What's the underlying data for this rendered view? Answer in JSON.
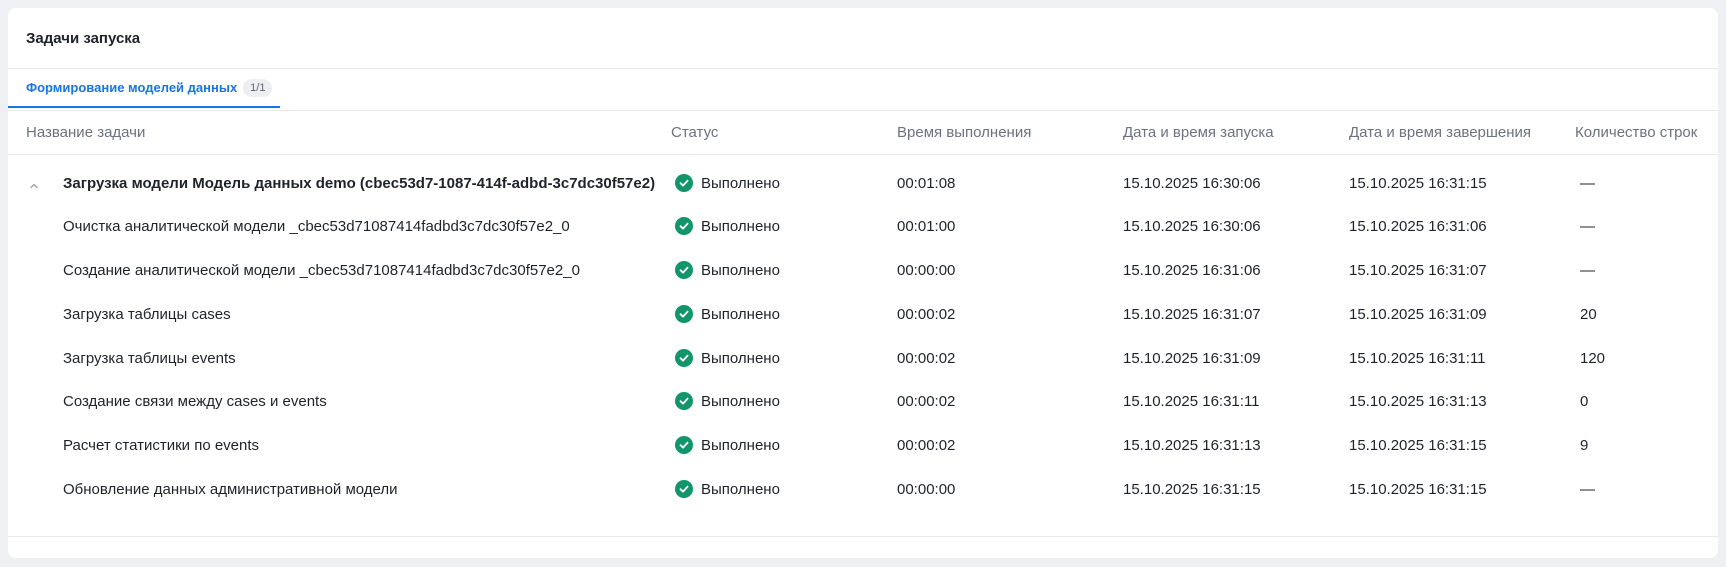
{
  "panel": {
    "title": "Задачи запуска"
  },
  "tabs": [
    {
      "label": "Формирование моделей данных",
      "badge": "1/1"
    }
  ],
  "table": {
    "columns": [
      "Название задачи",
      "Статус",
      "Время выполнения",
      "Дата и время запуска",
      "Дата и время завершения",
      "Количество строк"
    ],
    "rows": [
      {
        "name": "Загрузка модели Модель данных demo (cbec53d7-1087-414f-adbd-3c7dc30f57e2)",
        "status": "Выполнено",
        "duration": "00:01:08",
        "start": "15.10.2025 16:30:06",
        "end": "15.10.2025 16:31:15",
        "rows": "—"
      },
      {
        "name": "Очистка аналитической модели _cbec53d71087414fadbd3c7dc30f57e2_0",
        "status": "Выполнено",
        "duration": "00:01:00",
        "start": "15.10.2025 16:30:06",
        "end": "15.10.2025 16:31:06",
        "rows": "—"
      },
      {
        "name": "Создание аналитической модели _cbec53d71087414fadbd3c7dc30f57e2_0",
        "status": "Выполнено",
        "duration": "00:00:00",
        "start": "15.10.2025 16:31:06",
        "end": "15.10.2025 16:31:07",
        "rows": "—"
      },
      {
        "name": "Загрузка таблицы cases",
        "status": "Выполнено",
        "duration": "00:00:02",
        "start": "15.10.2025 16:31:07",
        "end": "15.10.2025 16:31:09",
        "rows": "20"
      },
      {
        "name": "Загрузка таблицы events",
        "status": "Выполнено",
        "duration": "00:00:02",
        "start": "15.10.2025 16:31:09",
        "end": "15.10.2025 16:31:11",
        "rows": "120"
      },
      {
        "name": "Создание связи между cases и events",
        "status": "Выполнено",
        "duration": "00:00:02",
        "start": "15.10.2025 16:31:11",
        "end": "15.10.2025 16:31:13",
        "rows": "0"
      },
      {
        "name": "Расчет статистики по events",
        "status": "Выполнено",
        "duration": "00:00:02",
        "start": "15.10.2025 16:31:13",
        "end": "15.10.2025 16:31:15",
        "rows": "9"
      },
      {
        "name": "Обновление данных административной модели",
        "status": "Выполнено",
        "duration": "00:00:00",
        "start": "15.10.2025 16:31:15",
        "end": "15.10.2025 16:31:15",
        "rows": "—"
      }
    ]
  },
  "icons": {
    "status": "check-circle-icon",
    "expand": "chevron-up-icon"
  },
  "colors": {
    "accent": "#1a73e8",
    "success": "#13956b"
  }
}
